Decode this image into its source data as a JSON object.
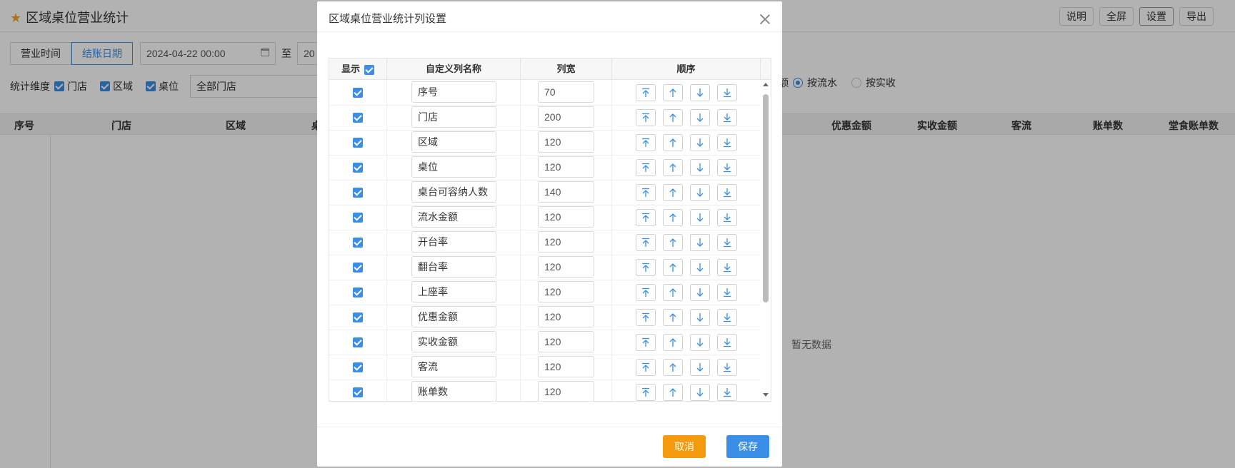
{
  "page": {
    "title": "区域桌位营业统计",
    "actions": [
      "说明",
      "全屏",
      "设置",
      "导出"
    ],
    "time_tabs": [
      "营业时间",
      "结账日期"
    ],
    "date_start": "2024-04-22 00:00",
    "date_sep": "至",
    "date_end_partial": "20",
    "dimension_label": "统计维度",
    "dimensions": [
      "门店",
      "区域",
      "桌位"
    ],
    "store_select": "全部门店",
    "radio_prefix": "额",
    "radio_flow": "按流水",
    "radio_actual": "按实收",
    "table_headers_left": [
      "序号",
      "门店",
      "区域",
      "桌"
    ],
    "table_headers_right": [
      "优惠金额",
      "实收金额",
      "客流",
      "账单数",
      "堂食账单数"
    ],
    "empty_text": "暂无数据"
  },
  "modal": {
    "title": "区域桌位营业统计列设置",
    "headers": {
      "show": "显示",
      "name": "自定义列名称",
      "width": "列宽",
      "order": "顺序"
    },
    "rows": [
      {
        "name": "序号",
        "width": "70"
      },
      {
        "name": "门店",
        "width": "200"
      },
      {
        "name": "区域",
        "width": "120"
      },
      {
        "name": "桌位",
        "width": "120"
      },
      {
        "name": "桌台可容纳人数",
        "width": "140"
      },
      {
        "name": "流水金额",
        "width": "120"
      },
      {
        "name": "开台率",
        "width": "120"
      },
      {
        "name": "翻台率",
        "width": "120"
      },
      {
        "name": "上座率",
        "width": "120"
      },
      {
        "name": "优惠金额",
        "width": "120"
      },
      {
        "name": "实收金额",
        "width": "120"
      },
      {
        "name": "客流",
        "width": "120"
      },
      {
        "name": "账单数",
        "width": "120"
      }
    ],
    "cancel_label": "取消",
    "save_label": "保存"
  },
  "colors": {
    "accent": "#3a8ee6",
    "cancel": "#f59a0e"
  }
}
